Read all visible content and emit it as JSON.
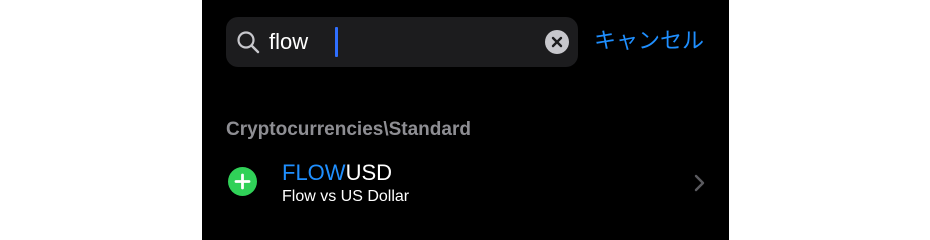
{
  "search": {
    "icon": "search-icon",
    "value": "flow",
    "placeholder": "",
    "clear_icon": "clear-circle-icon",
    "cancel_label": "キャンセル",
    "accent_color": "#1f8fff",
    "caret_color": "#2f6fff"
  },
  "results": {
    "section_title": "Cryptocurrencies\\Standard",
    "items": [
      {
        "symbol_match": "FLOW",
        "symbol_rest": "USD",
        "description": "Flow vs US Dollar",
        "add_icon": "plus-circle-icon",
        "add_color": "#30d158",
        "chevron_icon": "chevron-right-icon"
      }
    ]
  }
}
